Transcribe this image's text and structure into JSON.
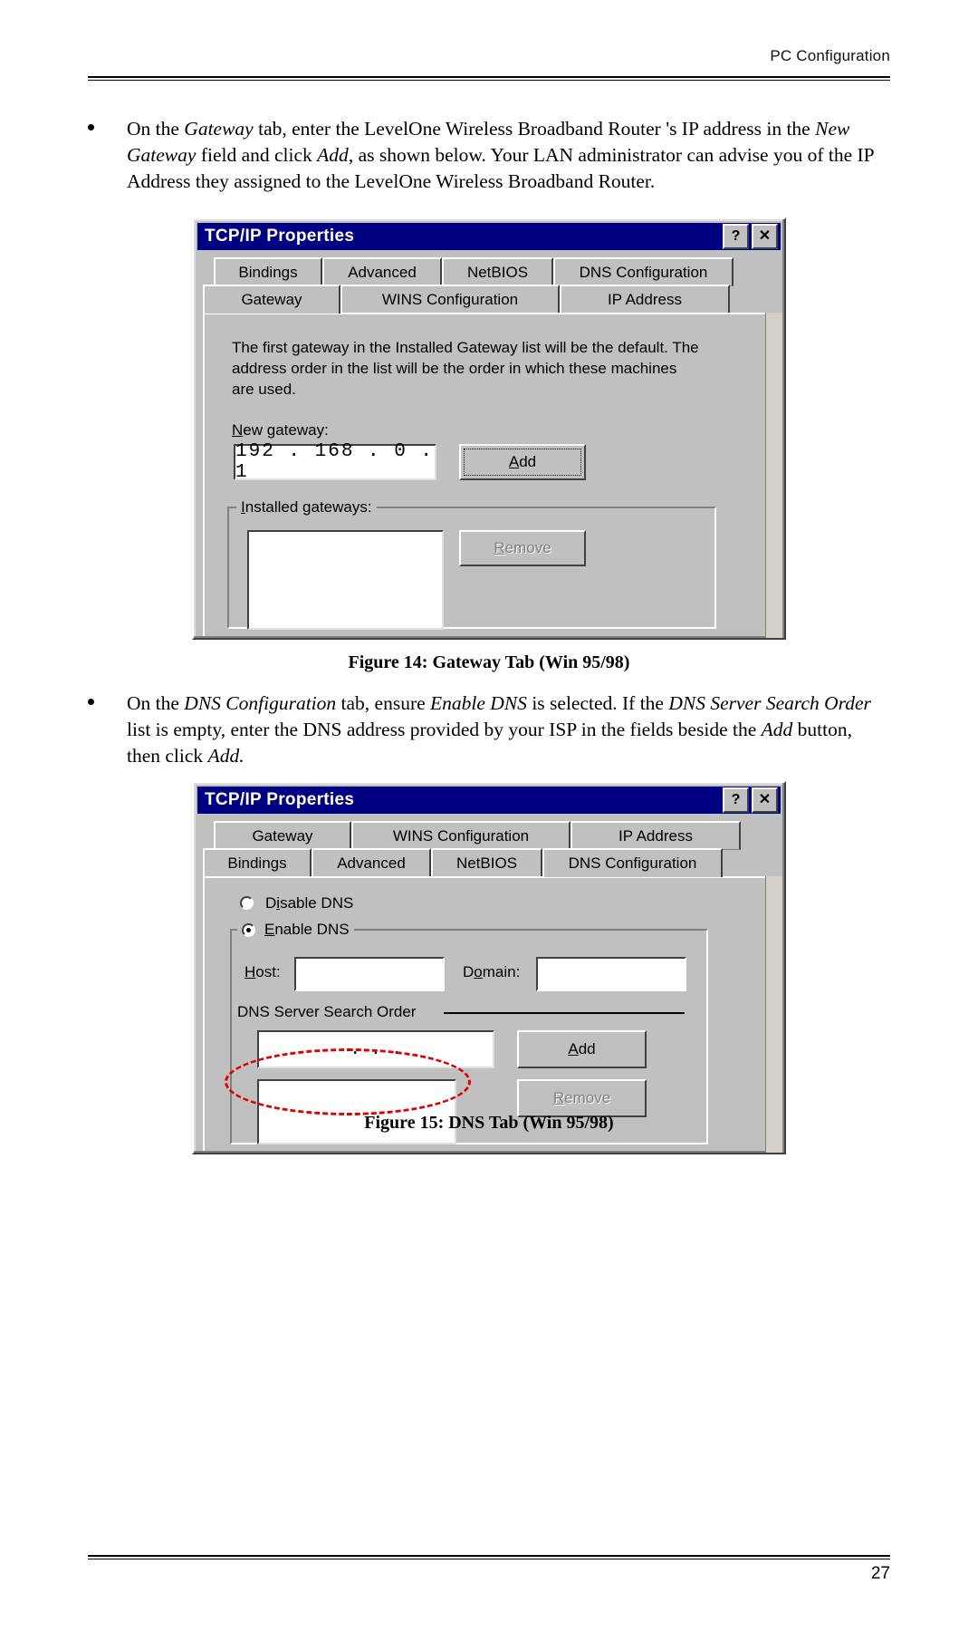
{
  "header": {
    "title": "PC Configuration"
  },
  "footer": {
    "page_number": "27"
  },
  "bullets": [
    {
      "id": "gateway-instruction",
      "segments": [
        {
          "t": "On the ",
          "i": false
        },
        {
          "t": "Gateway",
          "i": true
        },
        {
          "t": " tab, enter the LevelOne Wireless Broadband Router 's IP address in the ",
          "i": false
        },
        {
          "t": "New Gateway",
          "i": true
        },
        {
          "t": " field and click ",
          "i": false
        },
        {
          "t": "Add",
          "i": true
        },
        {
          "t": ", as shown below.  Your LAN administrator can advise you of the IP Address they assigned to the LevelOne Wireless Broadband Router.",
          "i": false
        }
      ]
    },
    {
      "id": "dns-instruction",
      "segments": [
        {
          "t": "On the ",
          "i": false
        },
        {
          "t": "DNS Configuration",
          "i": true
        },
        {
          "t": " tab, ensure ",
          "i": false
        },
        {
          "t": "Enable DNS",
          "i": true
        },
        {
          "t": " is selected. If the ",
          "i": false
        },
        {
          "t": "DNS Server Search Order",
          "i": true
        },
        {
          "t": " list is empty, enter the DNS address provided by your ISP in the fields beside the ",
          "i": false
        },
        {
          "t": "Add",
          "i": true
        },
        {
          "t": " button, then click ",
          "i": false
        },
        {
          "t": "Add.",
          "i": true
        }
      ]
    }
  ],
  "captions": {
    "figure14": "Figure 14: Gateway Tab (Win 95/98)",
    "figure15": "Figure 15: DNS Tab (Win 95/98)"
  },
  "dialog_gateway": {
    "title": "TCP/IP Properties",
    "titlebar_buttons": [
      {
        "name": "help-button",
        "glyph": "?"
      },
      {
        "name": "close-button",
        "glyph": "✕"
      }
    ],
    "tabs_row1": [
      "Bindings",
      "Advanced",
      "NetBIOS",
      "DNS Configuration"
    ],
    "tabs_row2": [
      "Gateway",
      "WINS Configuration",
      "IP Address"
    ],
    "active_tab": "Gateway",
    "description": "The first gateway in the Installed Gateway list will be the default. The address order in the list will be the order in which these machines are used.",
    "new_gateway_label": "New gateway:",
    "new_gateway_value": "192 . 168 .  0  .  1",
    "add_label": "Add",
    "installed_gateways_label": "Installed gateways:",
    "installed_gateways_items": [],
    "remove_label": "Remove",
    "remove_disabled": true
  },
  "dialog_dns": {
    "title": "TCP/IP Properties",
    "titlebar_buttons": [
      {
        "name": "help-button",
        "glyph": "?"
      },
      {
        "name": "close-button",
        "glyph": "✕"
      }
    ],
    "tabs_row1": [
      "Gateway",
      "WINS Configuration",
      "IP Address"
    ],
    "tabs_row2": [
      "Bindings",
      "Advanced",
      "NetBIOS",
      "DNS Configuration"
    ],
    "active_tab": "DNS Configuration",
    "radio_disable_label": "Disable DNS",
    "radio_enable_label": "Enable DNS",
    "radio_selected": "Enable DNS",
    "host_label": "Host:",
    "host_value": "",
    "domain_label": "Domain:",
    "domain_value": "",
    "search_order_label": "DNS Server Search Order",
    "search_order_value": ".        .        .",
    "add_label": "Add",
    "remove_label": "Remove",
    "remove_disabled": true,
    "search_order_items": [],
    "annotation_color": "#e00000"
  }
}
